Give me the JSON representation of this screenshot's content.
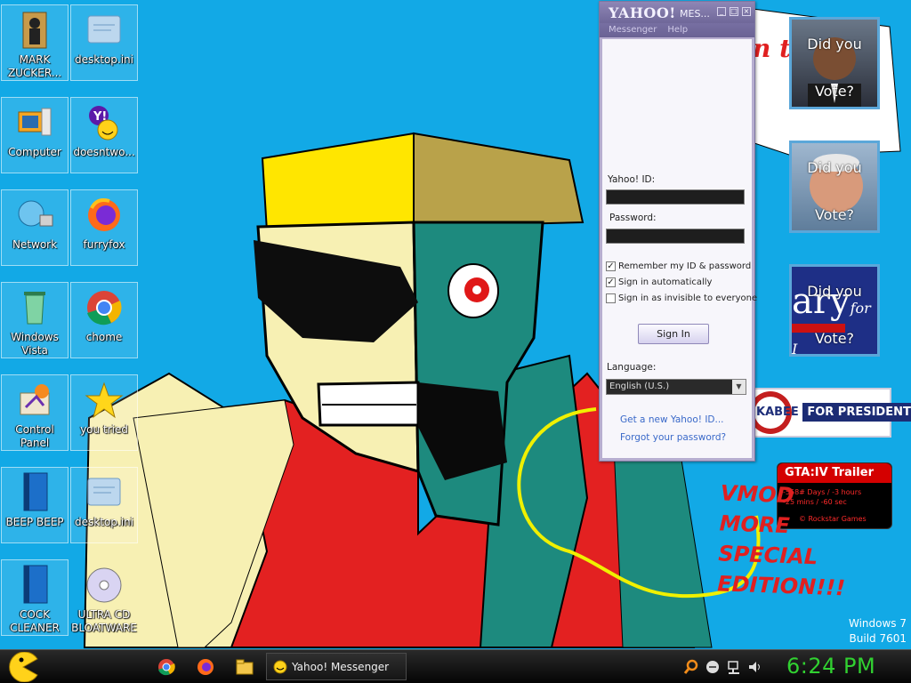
{
  "desktop": {
    "icons": [
      {
        "label": "MARK ZUCKER...",
        "icon": "book-figure-icon"
      },
      {
        "label": "desktop.ini",
        "icon": "settings-file-icon"
      },
      {
        "label": "Computer",
        "icon": "computer-icon"
      },
      {
        "label": "doesntwo...",
        "icon": "yahoo-messenger-icon"
      },
      {
        "label": "Network",
        "icon": "network-icon"
      },
      {
        "label": "furryfox",
        "icon": "firefox-icon"
      },
      {
        "label": "Windows Vista",
        "icon": "recycle-bin-icon"
      },
      {
        "label": "chome",
        "icon": "chrome-icon"
      },
      {
        "label": "Control Panel",
        "icon": "control-panel-icon"
      },
      {
        "label": "you tried",
        "icon": "star-icon"
      },
      {
        "label": "BEEP BEEP",
        "icon": "blue-book-icon"
      },
      {
        "label": "desktop.ini",
        "icon": "settings-file-icon"
      },
      {
        "label": "COCK CLEANER",
        "icon": "blue-book-icon"
      },
      {
        "label": "ULTRA CD BLOATWARE",
        "icon": "cd-icon"
      }
    ]
  },
  "yahoo_window": {
    "title_logo": "YAHOO!",
    "title_suffix": "MES...",
    "menu": [
      "Messenger",
      "Help"
    ],
    "yahoo_id_label": "Yahoo! ID:",
    "yahoo_id_value": "",
    "password_label": "Password:",
    "password_value": "",
    "checkboxes": [
      {
        "label": "Remember my ID & password",
        "checked": true
      },
      {
        "label": "Sign in automatically",
        "checked": true
      },
      {
        "label": "Sign in as invisible to everyone",
        "checked": false
      }
    ],
    "sign_in_label": "Sign In",
    "language_label": "Language:",
    "language_value": "English (U.S.)",
    "links": [
      "Get a new Yahoo! ID...",
      "Forgot your password?"
    ]
  },
  "right_widgets": {
    "speech_text": "n t",
    "vote_cards": [
      {
        "line1": "Did you",
        "line2": "Vote?"
      },
      {
        "line1": "Did you",
        "line2": "Vote?"
      },
      {
        "line1": "Did you",
        "line2": "Vote?"
      }
    ],
    "hillary_text": "ary",
    "hillary_sub": "for I",
    "huckabee_left": "KABEE",
    "huckabee_right": "FOR PRESIDENT",
    "gta": {
      "title": "GTA:IV  Trailer",
      "line1": "-558# Days / -3 hours",
      "line2": "-25 mins / -60 sec",
      "line3": "© Rockstar Games"
    },
    "vmod_lines": [
      "VMOD",
      "MORE",
      "SPECIAL",
      "EDITION!!!"
    ]
  },
  "os_info": {
    "line1": "Windows 7",
    "line2": "Build 7601"
  },
  "taskbar": {
    "start_icon": "pacman-start-icon",
    "pinned": [
      "chrome-icon",
      "firefox-icon",
      "folder-icon"
    ],
    "active_task": "Yahoo! Messenger",
    "tray": [
      "search-icon",
      "circle-minus-icon",
      "network-tray-icon",
      "volume-icon"
    ],
    "clock": "6:24 PM"
  },
  "colors": {
    "desktop_bg": "#12a9e6",
    "clock": "#31d131",
    "yahoo_purple": "#6f6799"
  }
}
